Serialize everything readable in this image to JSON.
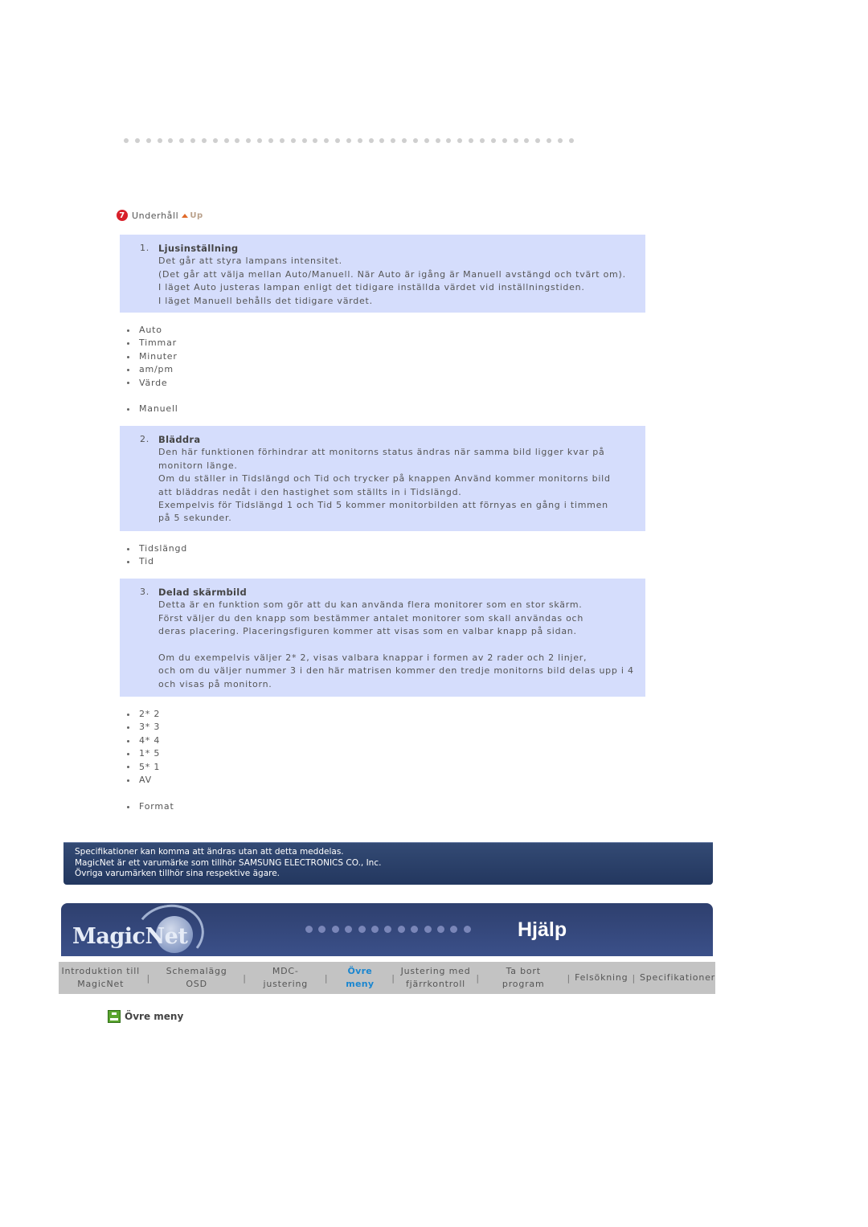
{
  "section": {
    "badge_number": "7",
    "title": "Underhåll",
    "up_label": "Up"
  },
  "items": [
    {
      "index": "1.",
      "title": "Ljusinställning",
      "lines": [
        "Det går att styra lampans intensitet.",
        "(Det går att välja mellan Auto/Manuell. När Auto är igång är Manuell avstängd och tvärt om).",
        "I läget Auto justeras lampan enligt det tidigare inställda värdet vid inställningstiden.",
        "I läget Manuell behålls det tidigare värdet."
      ]
    },
    {
      "index": "2.",
      "title": "Bläddra",
      "lines": [
        "Den här funktionen förhindrar att monitorns status ändras när samma bild ligger kvar på monitorn länge.",
        "Om du ställer in Tidslängd och Tid och trycker på knappen Använd kommer monitorns bild att bläddras nedåt i den hastighet som ställts in i Tidslängd.",
        "Exempelvis för Tidslängd 1 och Tid 5 kommer monitorbilden att förnyas en gång i timmen på 5 sekunder."
      ]
    },
    {
      "index": "3.",
      "title": "Delad skärmbild",
      "lines": [
        "Detta är en funktion som gör att du kan använda flera monitorer som en stor skärm.",
        "Först väljer du den knapp som bestämmer antalet monitorer som skall användas och deras placering. Placeringsfiguren kommer att visas som en valbar knapp på sidan.",
        "",
        "Om du exempelvis väljer 2* 2, visas valbara knappar i formen av 2 rader och 2 linjer,",
        "och om du väljer nummer 3 i den här matrisen kommer den tredje monitorns bild delas upp i 4 och visas på monitorn."
      ]
    }
  ],
  "lists": {
    "lamp": [
      "Auto",
      "Timmar",
      "Minuter",
      "am/pm",
      "Värde"
    ],
    "lamp_manual": [
      "Manuell"
    ],
    "scroll": [
      "Tidslängd",
      "Tid"
    ],
    "split": [
      "2* 2",
      "3* 3",
      "4* 4",
      "1* 5",
      "5* 1",
      "AV"
    ],
    "split_format": [
      "Format"
    ]
  },
  "notice": {
    "lines": [
      "Specifikationer kan komma att ändras utan att detta meddelas.",
      "MagicNet är ett varumärke som tillhör SAMSUNG ELECTRONICS CO., Inc.",
      "Övriga varumärken tillhör sina respektive ägare."
    ]
  },
  "banner": {
    "logo": "MagicNet",
    "title": "Hjälp"
  },
  "nav": {
    "items": [
      {
        "label1": "Introduktion till",
        "label2": "MagicNet"
      },
      {
        "label1": "Schemalägg OSD"
      },
      {
        "label1": "MDC-justering"
      },
      {
        "label1": "Övre meny",
        "active": true
      },
      {
        "label1": "Justering med",
        "label2": "fjärrkontroll"
      },
      {
        "label1": "Ta bort program"
      },
      {
        "label1": "Felsökning"
      },
      {
        "label1": "Specifikationer"
      }
    ],
    "separator": "|"
  },
  "footer_section": {
    "title": "Övre meny"
  },
  "colors": {
    "box_bg": "#d5ddfc",
    "nav_active": "#1a86d0",
    "banner_bg": "#2e3f6e",
    "badge_red": "#d8202a"
  }
}
